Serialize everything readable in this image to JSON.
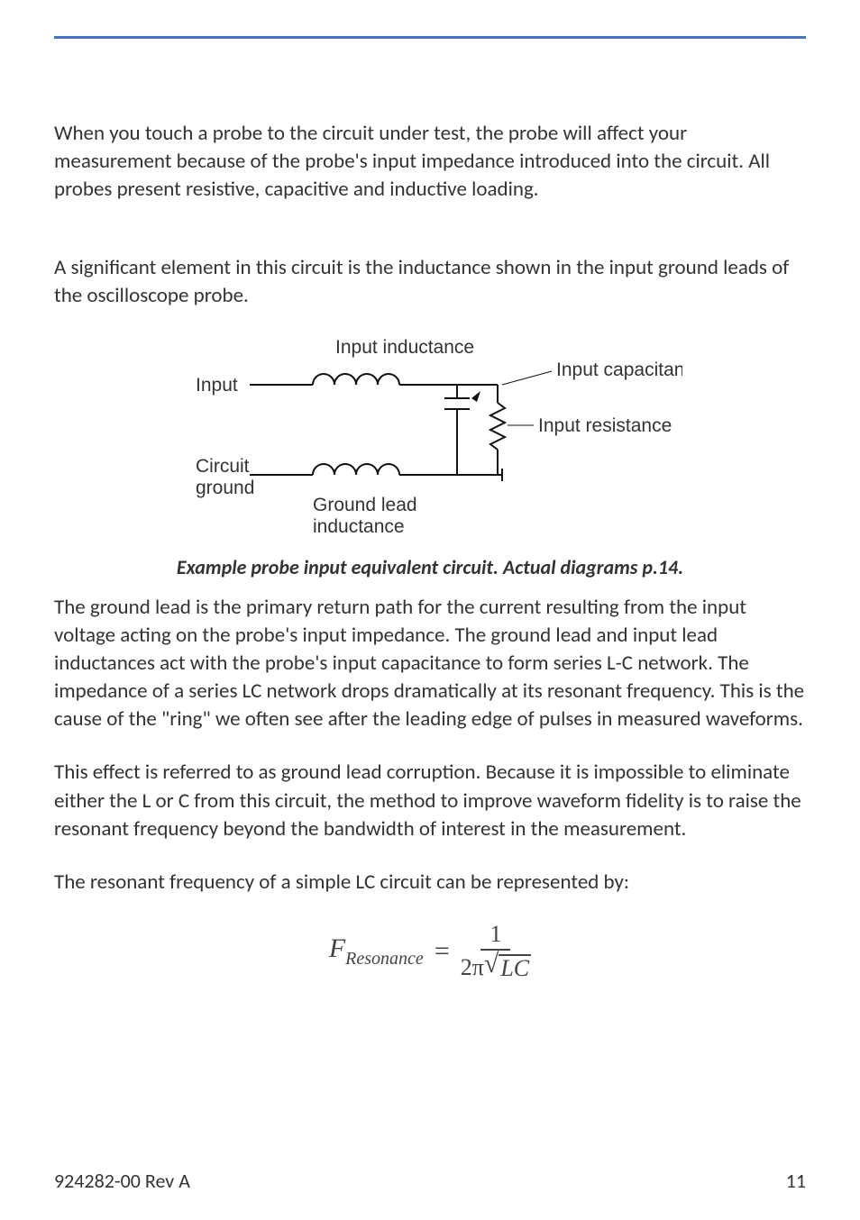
{
  "paragraphs": {
    "p1": "When you touch a probe to the circuit under test, the probe will affect your measurement because of the probe's input impedance introduced into the circuit. All probes present resistive, capacitive and inductive loading.",
    "p2": "A significant element in this circuit is the inductance shown in the input ground leads of the oscilloscope probe.",
    "p3": "The ground lead is the primary return path for the current resulting from the input voltage acting on the probe's input impedance. The ground lead and input lead inductances act with the probe's input capacitance to form series L-C network. The impedance of a series LC network drops dramatically at its resonant frequency. This is the cause of the \"ring\" we often see after the leading edge of pulses in measured waveforms.",
    "p4": "This effect is referred to as ground lead corruption. Because it is impossible to eliminate either the L or C from this circuit, the method to improve waveform fidelity is to raise the resonant frequency beyond the bandwidth of interest in the measurement.",
    "p5": "The resonant frequency of a simple LC circuit can be represented by:"
  },
  "diagram": {
    "label_input_inductance": "Input inductance",
    "label_input": "Input",
    "label_input_capacitance": "Input capacitance",
    "label_input_resistance": "Input resistance",
    "label_circuit": "Circuit",
    "label_ground": "ground",
    "label_ground_lead": "Ground lead",
    "label_inductance": "inductance"
  },
  "caption": "Example probe input equivalent circuit. Actual diagrams p.14.",
  "formula": {
    "F": "F",
    "sub": "Resonance",
    "eq": "=",
    "num": "1",
    "two_pi": "2π",
    "LC": "LC"
  },
  "footer": {
    "doc_id": "924282-00 Rev A",
    "page_num": "11"
  }
}
